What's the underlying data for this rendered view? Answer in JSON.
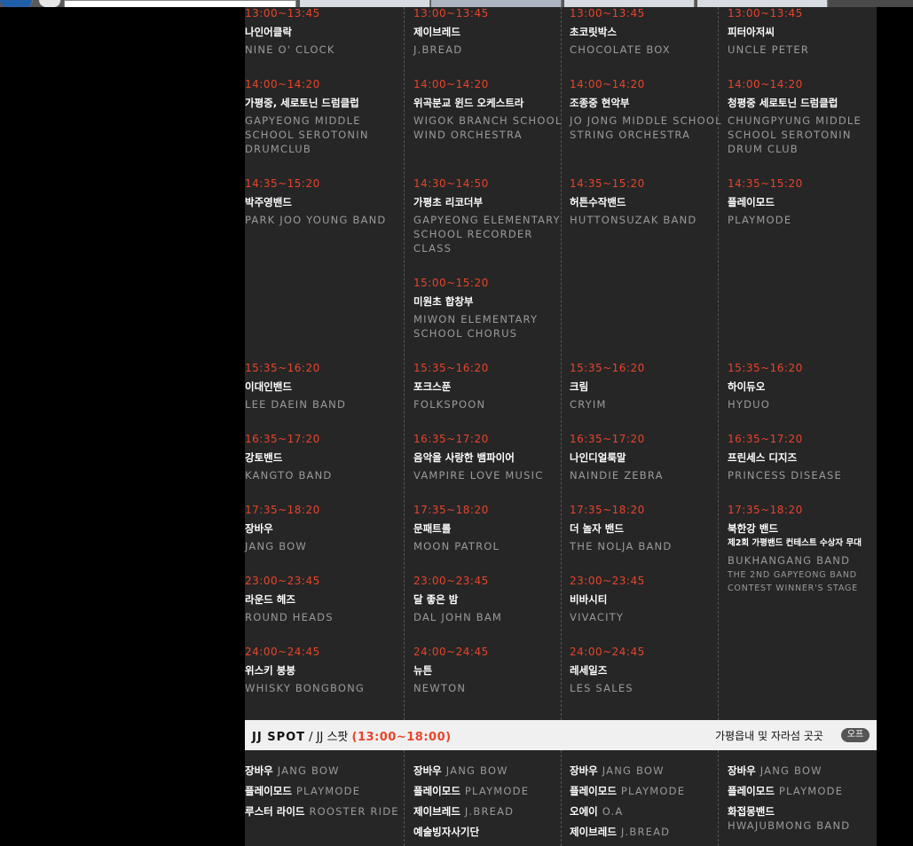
{
  "schedule": {
    "columns": [
      {
        "slots": [
          {
            "time": "13:00~13:45",
            "ko": "나인어클락",
            "en": "NINE O' CLOCK"
          },
          {
            "time": "14:00~14:20",
            "ko": "가평중, 세로토닌 드럼클럽",
            "en": "GAPYEONG MIDDLE SCHOOL SEROTONIN DRUMCLUB"
          },
          {
            "time": "14:35~15:20",
            "ko": "박주영밴드",
            "en": "PARK JOO YOUNG BAND"
          },
          {
            "time": "15:35~16:20",
            "ko": "이대인밴드",
            "en": "LEE DAEIN BAND"
          },
          {
            "time": "16:35~17:20",
            "ko": "강토밴드",
            "en": "KANGTO BAND"
          },
          {
            "time": "17:35~18:20",
            "ko": "장바우",
            "en": "JANG BOW"
          },
          {
            "time": "23:00~23:45",
            "ko": "라운드 헤즈",
            "en": "ROUND HEADS"
          },
          {
            "time": "24:00~24:45",
            "ko": "위스키 봉봉",
            "en": "WHISKY BONGBONG"
          }
        ]
      },
      {
        "slots": [
          {
            "time": "13:00~13:45",
            "ko": "제이브레드",
            "en": "J.BREAD"
          },
          {
            "time": "14:00~14:20",
            "ko": "위곡분교 윈드 오케스트라",
            "en": "WIGOK BRANCH SCHOOL WIND ORCHESTRA"
          },
          {
            "time": "14:30~14:50",
            "ko": "가평초 리코더부",
            "en": "GAPYEONG ELEMENTARY SCHOOL RECORDER CLASS"
          },
          {
            "time": "15:00~15:20",
            "ko": "미원초 합창부",
            "en": "MIWON ELEMENTARY SCHOOL CHORUS"
          },
          {
            "time": "15:35~16:20",
            "ko": "포크스푼",
            "en": "FOLKSPOON"
          },
          {
            "time": "16:35~17:20",
            "ko": "음악을 사랑한 뱀파이어",
            "en": "VAMPIRE LOVE MUSIC"
          },
          {
            "time": "17:35~18:20",
            "ko": "문패트롤",
            "en": "MOON PATROL"
          },
          {
            "time": "23:00~23:45",
            "ko": "달 좋은 밤",
            "en": "DAL JOHN BAM"
          },
          {
            "time": "24:00~24:45",
            "ko": "뉴튼",
            "en": "NEWTON"
          }
        ]
      },
      {
        "slots": [
          {
            "time": "13:00~13:45",
            "ko": "초코릿박스",
            "en": "CHOCOLATE BOX"
          },
          {
            "time": "14:00~14:20",
            "ko": "조종중 현악부",
            "en": "JO JONG MIDDLE SCHOOL STRING ORCHESTRA"
          },
          {
            "time": "14:35~15:20",
            "ko": "허튼수작밴드",
            "en": "HUTTONSUZAK BAND"
          },
          {
            "time": "15:35~16:20",
            "ko": "크림",
            "en": "CRYIM"
          },
          {
            "time": "16:35~17:20",
            "ko": "나인디얼룩말",
            "en": "NAINDIE ZEBRA"
          },
          {
            "time": "17:35~18:20",
            "ko": "더 놀자 밴드",
            "en": "THE NOLJA BAND"
          },
          {
            "time": "23:00~23:45",
            "ko": "비바시티",
            "en": "VIVACITY"
          },
          {
            "time": "24:00~24:45",
            "ko": "레세일즈",
            "en": "LES SALES"
          }
        ]
      },
      {
        "slots": [
          {
            "time": "13:00~13:45",
            "ko": "피터아저씨",
            "en": "UNCLE PETER"
          },
          {
            "time": "14:00~14:20",
            "ko": "청평중 세로토닌 드럼클럽",
            "en": "CHUNGPYUNG MIDDLE SCHOOL SEROTONIN DRUM CLUB"
          },
          {
            "time": "14:35~15:20",
            "ko": "플레이모드",
            "en": "PLAYMODE"
          },
          {
            "time": "15:35~16:20",
            "ko": "하이듀오",
            "en": "HYDUO"
          },
          {
            "time": "16:35~17:20",
            "ko": "프린세스 디지즈",
            "en": "PRINCESS DISEASE"
          },
          {
            "time": "17:35~18:20",
            "ko": "북한강 밴드",
            "note": "제2회 가평밴드 컨테스트 수상자 무대",
            "en": "BUKHANGANG BAND",
            "note_en": "THE 2ND GAPYEONG BAND CONTEST WINNER'S STAGE"
          }
        ]
      }
    ]
  },
  "jj_spot": {
    "title_en": "JJ SPOT",
    "title_ko": "/ JJ 스팟",
    "hours": "(13:00~18:00)",
    "location": "가평읍내 및 자라섬 곳곳",
    "badge": "오프",
    "columns": [
      [
        {
          "ko": "장바우",
          "en": "JANG BOW"
        },
        {
          "ko": "플레이모드",
          "en": "PLAYMODE"
        },
        {
          "ko": "루스터 라이드",
          "en": "ROOSTER RIDE"
        }
      ],
      [
        {
          "ko": "장바우",
          "en": "JANG BOW"
        },
        {
          "ko": "플레이모드",
          "en": "PLAYMODE"
        },
        {
          "ko": "제이브레드",
          "en": "J.BREAD"
        },
        {
          "ko": "예술빙자사기단",
          "en": ""
        }
      ],
      [
        {
          "ko": "장바우",
          "en": "JANG BOW"
        },
        {
          "ko": "플레이모드",
          "en": "PLAYMODE"
        },
        {
          "ko": "오에이",
          "en": "O.A"
        },
        {
          "ko": "제이브레드",
          "en": "J.BREAD"
        }
      ],
      [
        {
          "ko": "장바우",
          "en": "JANG BOW"
        },
        {
          "ko": "플레이모드",
          "en": "PLAYMODE"
        },
        {
          "ko": "화접몽밴드",
          "en": "HWAJUBMONG BAND"
        }
      ]
    ]
  },
  "colors": {
    "accent": "#e8442a",
    "panel": "#262626",
    "text_en": "#9a9a9a"
  }
}
